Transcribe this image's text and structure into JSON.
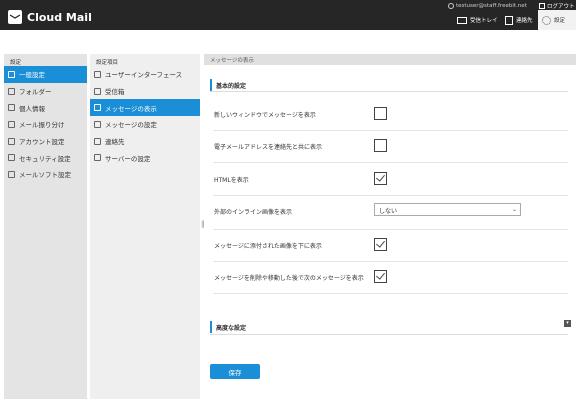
{
  "header": {
    "app_title": "Cloud Mail",
    "user_email": "testuser@staff.freebit.net",
    "logout_label": "ログアウト",
    "nav": {
      "inbox_label": "受信トレイ",
      "contacts_label": "連絡先",
      "settings_label": "設定"
    }
  },
  "sidebar": {
    "header": "設定",
    "items": [
      {
        "label": "一般設定",
        "icon": "gear-icon",
        "active": true
      },
      {
        "label": "フォルダー",
        "icon": "folder-icon",
        "active": false
      },
      {
        "label": "個人情報",
        "icon": "person-icon",
        "active": false
      },
      {
        "label": "メール振り分け",
        "icon": "filter-icon",
        "active": false
      },
      {
        "label": "アカウント設定",
        "icon": "account-icon",
        "active": false
      },
      {
        "label": "セキュリティ設定",
        "icon": "shield-icon",
        "active": false
      },
      {
        "label": "メールソフト設定",
        "icon": "mail-client-icon",
        "active": false
      }
    ]
  },
  "subnav": {
    "header": "設定項目",
    "items": [
      {
        "label": "ユーザーインターフェース",
        "icon": "monitor-icon",
        "active": false
      },
      {
        "label": "受信箱",
        "icon": "inbox-icon",
        "active": false
      },
      {
        "label": "メッセージの表示",
        "icon": "document-icon",
        "active": true
      },
      {
        "label": "メッセージの設定",
        "icon": "edit-icon",
        "active": false
      },
      {
        "label": "連絡先",
        "icon": "contact-icon",
        "active": false
      },
      {
        "label": "サーバーの設定",
        "icon": "server-icon",
        "active": false
      }
    ]
  },
  "main": {
    "breadcrumb": "メッセージの表示",
    "basic_section_title": "基本的設定",
    "advanced_section_title": "高度な設定",
    "options": {
      "new_window": {
        "label": "新しいウィンドウでメッセージを表示",
        "checked": false
      },
      "show_with_contact": {
        "label": "電子メールアドレスを連絡先と共に表示",
        "checked": false
      },
      "show_html": {
        "label": "HTMLを表示",
        "checked": true
      },
      "inline_images": {
        "label": "外部のインライン画像を表示",
        "value": "しない"
      },
      "attached_below": {
        "label": "メッセージに添付された画像を下に表示",
        "checked": true
      },
      "next_after_delete": {
        "label": "メッセージを削除や移動した後で次のメッセージを表示",
        "checked": true
      }
    },
    "save_label": "保存"
  },
  "colors": {
    "accent": "#1a8ed6",
    "topbar": "#262626"
  }
}
